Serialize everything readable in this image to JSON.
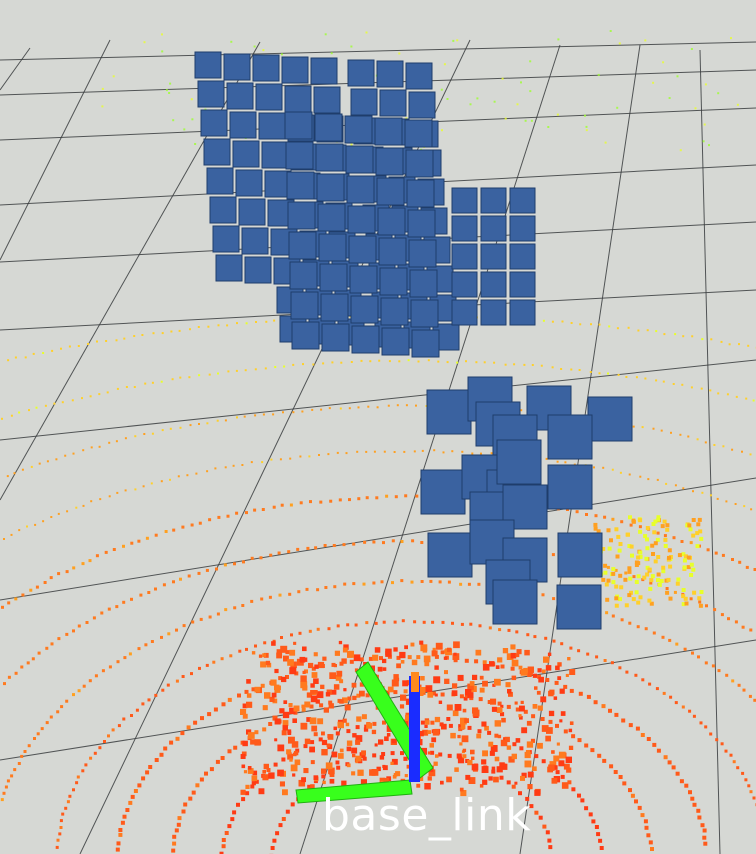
{
  "viewport": {
    "background_color": "#d6d8d4",
    "grid_color": "#3a3d3f",
    "pointcloud_colors": [
      "#ff3b14",
      "#ff5a1a",
      "#ff7a1f",
      "#ffa020",
      "#ffd02a",
      "#e8ff2a",
      "#9dff30"
    ],
    "marker_color": "#3a62a0",
    "marker_edge_color": "#1f3d6b",
    "tf_frame": {
      "label": "base_link",
      "axis_colors": {
        "x": "#ff2a2a",
        "y": "#38ff1c",
        "z": "#1a2cff"
      }
    }
  }
}
